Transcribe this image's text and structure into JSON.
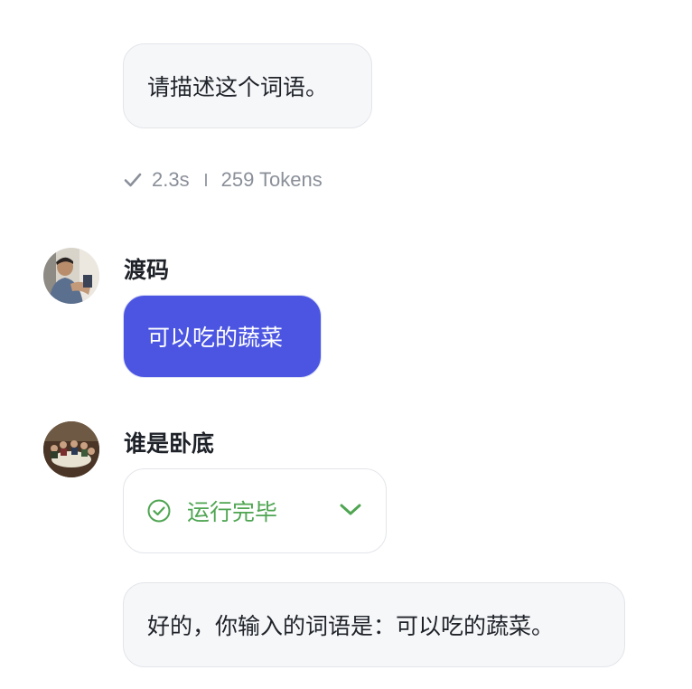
{
  "messages": {
    "prompt_text": "请描述这个词语。",
    "meta": {
      "time": "2.3s",
      "tokens": "259 Tokens"
    },
    "user": {
      "name": "渡码",
      "text": "可以吃的蔬菜"
    },
    "assistant": {
      "name": "谁是卧底",
      "tool_status": "运行完毕",
      "reply": "好的，你输入的词语是：可以吃的蔬菜。"
    }
  },
  "colors": {
    "user_bubble": "#4b55e1",
    "status_green": "#4fa552",
    "muted_text": "#8a8f99",
    "bubble_bg": "#f6f7f9"
  },
  "icons": [
    "check-icon",
    "check-circle-icon",
    "chevron-down-icon"
  ]
}
